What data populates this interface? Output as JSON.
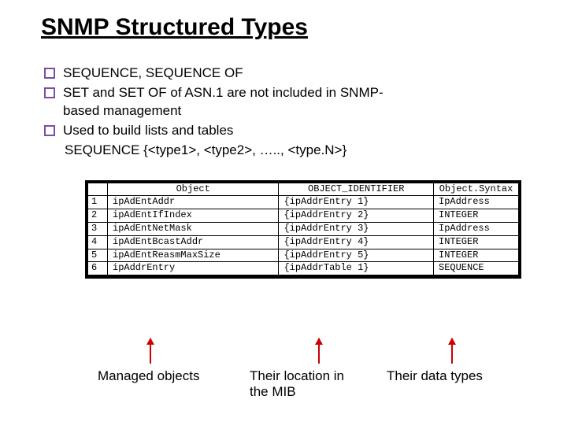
{
  "title": "SNMP Structured Types",
  "bullets": {
    "b1": "SEQUENCE, SEQUENCE OF",
    "b2": "SET and SET OF of ASN.1 are not included in SNMP-based management",
    "b3": "Used to build lists and tables",
    "b3_sub": "SEQUENCE {<type1>, <type2>, ….., <type.N>}"
  },
  "table": {
    "head": {
      "c1": "Object",
      "c2": "OBJECT_IDENTIFIER",
      "c3": "Object.Syntax"
    },
    "rows": [
      {
        "n": "1",
        "obj": "ipAdEntAddr",
        "oid": "{ipAddrEntry 1}",
        "syn": "IpAddress"
      },
      {
        "n": "2",
        "obj": "ipAdEntIfIndex",
        "oid": "{ipAddrEntry 2}",
        "syn": "INTEGER"
      },
      {
        "n": "3",
        "obj": "ipAdEntNetMask",
        "oid": "{ipAddrEntry 3}",
        "syn": "IpAddress"
      },
      {
        "n": "4",
        "obj": "ipAdEntBcastAddr",
        "oid": "{ipAddrEntry 4}",
        "syn": "INTEGER"
      },
      {
        "n": "5",
        "obj": "ipAdEntReasmMaxSize",
        "oid": "{ipAddrEntry 5}",
        "syn": "INTEGER"
      },
      {
        "n": "6",
        "obj": "ipAddrEntry",
        "oid": "{ipAddrTable 1}",
        "syn": "SEQUENCE"
      }
    ]
  },
  "captions": {
    "c1": "Managed objects",
    "c2a": "Their location in",
    "c2b": "the MIB",
    "c3": "Their data types"
  }
}
